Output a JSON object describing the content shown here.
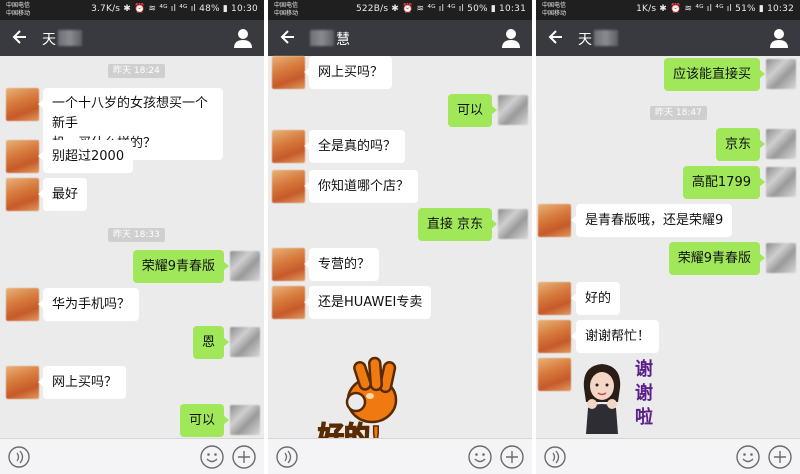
{
  "panels": [
    {
      "status": {
        "carrier_1": "中国电信",
        "carrier_2": "中国移动",
        "right_text": "3.7K/s ✱ ⏰ ≋ ⁴ᴳ ıl ⁴ᴳ ıl 48% ▮ 10:30"
      },
      "contact_name": "天",
      "times": [
        "昨天 18:24",
        "昨天 18:33"
      ],
      "messages": [
        {
          "side": "left",
          "lines": [
            "一个十八岁的女孩想买一个新手",
            "机，买什么样的？"
          ]
        },
        {
          "side": "left",
          "text": "别超过2000"
        },
        {
          "side": "left",
          "text": "最好"
        },
        {
          "side": "right",
          "text": "荣耀9青春版"
        },
        {
          "side": "left",
          "text": "华为手机吗？"
        },
        {
          "side": "right",
          "text": "恩"
        },
        {
          "side": "left",
          "text": "网上买吗？"
        },
        {
          "side": "right",
          "text": "可以"
        }
      ]
    },
    {
      "status": {
        "carrier_1": "中国电信",
        "carrier_2": "中国移动",
        "right_text": "522B/s ✱ ⏰ ≋ ⁴ᴳ ıl ⁴ᴳ ıl 50% ▮ 10:31"
      },
      "contact_name": "慧",
      "messages": [
        {
          "side": "left",
          "text": "网上买吗？"
        },
        {
          "side": "right",
          "text": "可以"
        },
        {
          "side": "left",
          "text": "全是真的吗？"
        },
        {
          "side": "left",
          "text": "你知道哪个店？"
        },
        {
          "side": "right",
          "text": "直接 京东"
        },
        {
          "side": "left",
          "text": "专营的？"
        },
        {
          "side": "left",
          "text": "还是HUAWEI专卖"
        }
      ],
      "sticker_text": "好的!"
    },
    {
      "status": {
        "carrier_1": "中国电信",
        "carrier_2": "中国移动",
        "right_text": "1K/s ✱ ⏰ ≋ ⁴ᴳ ıl ⁴ᴳ ıl 51% ▮ 10:32"
      },
      "contact_name": "天",
      "times": [
        "昨天 18:47"
      ],
      "messages": [
        {
          "side": "right",
          "text": "应该能直接买"
        },
        {
          "side": "right",
          "text": "京东"
        },
        {
          "side": "right",
          "text": "高配1799"
        },
        {
          "side": "left",
          "text": "是青春版哦，还是荣耀9"
        },
        {
          "side": "right",
          "text": "荣耀9青春版"
        },
        {
          "side": "left",
          "text": "好的"
        },
        {
          "side": "left",
          "text": "谢谢帮忙！"
        }
      ],
      "sticker_text": [
        "谢",
        "谢",
        "啦"
      ]
    }
  ],
  "icons": {
    "back": "back-arrow-icon",
    "contact": "contact-profile-icon",
    "voice": "voice-input-icon",
    "emoji": "emoji-icon",
    "plus": "plus-icon"
  },
  "colors": {
    "chat_bg": "#ebebeb",
    "topbar": "#393a3f",
    "bubble_sent": "#a0e759",
    "bubble_received": "#ffffff",
    "sticker_orange": "#f07a12",
    "sticker_purple": "#5a1f8a"
  }
}
